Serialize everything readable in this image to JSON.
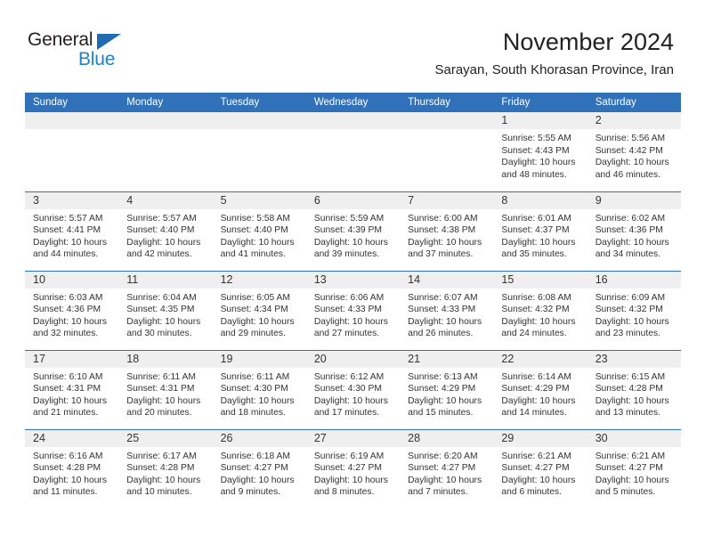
{
  "brand": {
    "name_top": "General",
    "name_bottom": "Blue",
    "triangle_color": "#1f6cb0",
    "text_color_top": "#231f20",
    "text_color_bottom": "#2083c8"
  },
  "header": {
    "title": "November 2024",
    "subtitle": "Sarayan, South Khorasan Province, Iran",
    "accent_color": "#3071b9",
    "band_color": "#efefef"
  },
  "weekdays": [
    "Sunday",
    "Monday",
    "Tuesday",
    "Wednesday",
    "Thursday",
    "Friday",
    "Saturday"
  ],
  "weeks": [
    [
      {
        "day": "",
        "empty": true
      },
      {
        "day": "",
        "empty": true
      },
      {
        "day": "",
        "empty": true
      },
      {
        "day": "",
        "empty": true
      },
      {
        "day": "",
        "empty": true
      },
      {
        "day": "1",
        "sunrise": "Sunrise: 5:55 AM",
        "sunset": "Sunset: 4:43 PM",
        "daylight1": "Daylight: 10 hours",
        "daylight2": "and 48 minutes."
      },
      {
        "day": "2",
        "sunrise": "Sunrise: 5:56 AM",
        "sunset": "Sunset: 4:42 PM",
        "daylight1": "Daylight: 10 hours",
        "daylight2": "and 46 minutes."
      }
    ],
    [
      {
        "day": "3",
        "sunrise": "Sunrise: 5:57 AM",
        "sunset": "Sunset: 4:41 PM",
        "daylight1": "Daylight: 10 hours",
        "daylight2": "and 44 minutes."
      },
      {
        "day": "4",
        "sunrise": "Sunrise: 5:57 AM",
        "sunset": "Sunset: 4:40 PM",
        "daylight1": "Daylight: 10 hours",
        "daylight2": "and 42 minutes."
      },
      {
        "day": "5",
        "sunrise": "Sunrise: 5:58 AM",
        "sunset": "Sunset: 4:40 PM",
        "daylight1": "Daylight: 10 hours",
        "daylight2": "and 41 minutes."
      },
      {
        "day": "6",
        "sunrise": "Sunrise: 5:59 AM",
        "sunset": "Sunset: 4:39 PM",
        "daylight1": "Daylight: 10 hours",
        "daylight2": "and 39 minutes."
      },
      {
        "day": "7",
        "sunrise": "Sunrise: 6:00 AM",
        "sunset": "Sunset: 4:38 PM",
        "daylight1": "Daylight: 10 hours",
        "daylight2": "and 37 minutes."
      },
      {
        "day": "8",
        "sunrise": "Sunrise: 6:01 AM",
        "sunset": "Sunset: 4:37 PM",
        "daylight1": "Daylight: 10 hours",
        "daylight2": "and 35 minutes."
      },
      {
        "day": "9",
        "sunrise": "Sunrise: 6:02 AM",
        "sunset": "Sunset: 4:36 PM",
        "daylight1": "Daylight: 10 hours",
        "daylight2": "and 34 minutes."
      }
    ],
    [
      {
        "day": "10",
        "sunrise": "Sunrise: 6:03 AM",
        "sunset": "Sunset: 4:36 PM",
        "daylight1": "Daylight: 10 hours",
        "daylight2": "and 32 minutes."
      },
      {
        "day": "11",
        "sunrise": "Sunrise: 6:04 AM",
        "sunset": "Sunset: 4:35 PM",
        "daylight1": "Daylight: 10 hours",
        "daylight2": "and 30 minutes."
      },
      {
        "day": "12",
        "sunrise": "Sunrise: 6:05 AM",
        "sunset": "Sunset: 4:34 PM",
        "daylight1": "Daylight: 10 hours",
        "daylight2": "and 29 minutes."
      },
      {
        "day": "13",
        "sunrise": "Sunrise: 6:06 AM",
        "sunset": "Sunset: 4:33 PM",
        "daylight1": "Daylight: 10 hours",
        "daylight2": "and 27 minutes."
      },
      {
        "day": "14",
        "sunrise": "Sunrise: 6:07 AM",
        "sunset": "Sunset: 4:33 PM",
        "daylight1": "Daylight: 10 hours",
        "daylight2": "and 26 minutes."
      },
      {
        "day": "15",
        "sunrise": "Sunrise: 6:08 AM",
        "sunset": "Sunset: 4:32 PM",
        "daylight1": "Daylight: 10 hours",
        "daylight2": "and 24 minutes."
      },
      {
        "day": "16",
        "sunrise": "Sunrise: 6:09 AM",
        "sunset": "Sunset: 4:32 PM",
        "daylight1": "Daylight: 10 hours",
        "daylight2": "and 23 minutes."
      }
    ],
    [
      {
        "day": "17",
        "sunrise": "Sunrise: 6:10 AM",
        "sunset": "Sunset: 4:31 PM",
        "daylight1": "Daylight: 10 hours",
        "daylight2": "and 21 minutes."
      },
      {
        "day": "18",
        "sunrise": "Sunrise: 6:11 AM",
        "sunset": "Sunset: 4:31 PM",
        "daylight1": "Daylight: 10 hours",
        "daylight2": "and 20 minutes."
      },
      {
        "day": "19",
        "sunrise": "Sunrise: 6:11 AM",
        "sunset": "Sunset: 4:30 PM",
        "daylight1": "Daylight: 10 hours",
        "daylight2": "and 18 minutes."
      },
      {
        "day": "20",
        "sunrise": "Sunrise: 6:12 AM",
        "sunset": "Sunset: 4:30 PM",
        "daylight1": "Daylight: 10 hours",
        "daylight2": "and 17 minutes."
      },
      {
        "day": "21",
        "sunrise": "Sunrise: 6:13 AM",
        "sunset": "Sunset: 4:29 PM",
        "daylight1": "Daylight: 10 hours",
        "daylight2": "and 15 minutes."
      },
      {
        "day": "22",
        "sunrise": "Sunrise: 6:14 AM",
        "sunset": "Sunset: 4:29 PM",
        "daylight1": "Daylight: 10 hours",
        "daylight2": "and 14 minutes."
      },
      {
        "day": "23",
        "sunrise": "Sunrise: 6:15 AM",
        "sunset": "Sunset: 4:28 PM",
        "daylight1": "Daylight: 10 hours",
        "daylight2": "and 13 minutes."
      }
    ],
    [
      {
        "day": "24",
        "sunrise": "Sunrise: 6:16 AM",
        "sunset": "Sunset: 4:28 PM",
        "daylight1": "Daylight: 10 hours",
        "daylight2": "and 11 minutes."
      },
      {
        "day": "25",
        "sunrise": "Sunrise: 6:17 AM",
        "sunset": "Sunset: 4:28 PM",
        "daylight1": "Daylight: 10 hours",
        "daylight2": "and 10 minutes."
      },
      {
        "day": "26",
        "sunrise": "Sunrise: 6:18 AM",
        "sunset": "Sunset: 4:27 PM",
        "daylight1": "Daylight: 10 hours",
        "daylight2": "and 9 minutes."
      },
      {
        "day": "27",
        "sunrise": "Sunrise: 6:19 AM",
        "sunset": "Sunset: 4:27 PM",
        "daylight1": "Daylight: 10 hours",
        "daylight2": "and 8 minutes."
      },
      {
        "day": "28",
        "sunrise": "Sunrise: 6:20 AM",
        "sunset": "Sunset: 4:27 PM",
        "daylight1": "Daylight: 10 hours",
        "daylight2": "and 7 minutes."
      },
      {
        "day": "29",
        "sunrise": "Sunrise: 6:21 AM",
        "sunset": "Sunset: 4:27 PM",
        "daylight1": "Daylight: 10 hours",
        "daylight2": "and 6 minutes."
      },
      {
        "day": "30",
        "sunrise": "Sunrise: 6:21 AM",
        "sunset": "Sunset: 4:27 PM",
        "daylight1": "Daylight: 10 hours",
        "daylight2": "and 5 minutes."
      }
    ]
  ]
}
